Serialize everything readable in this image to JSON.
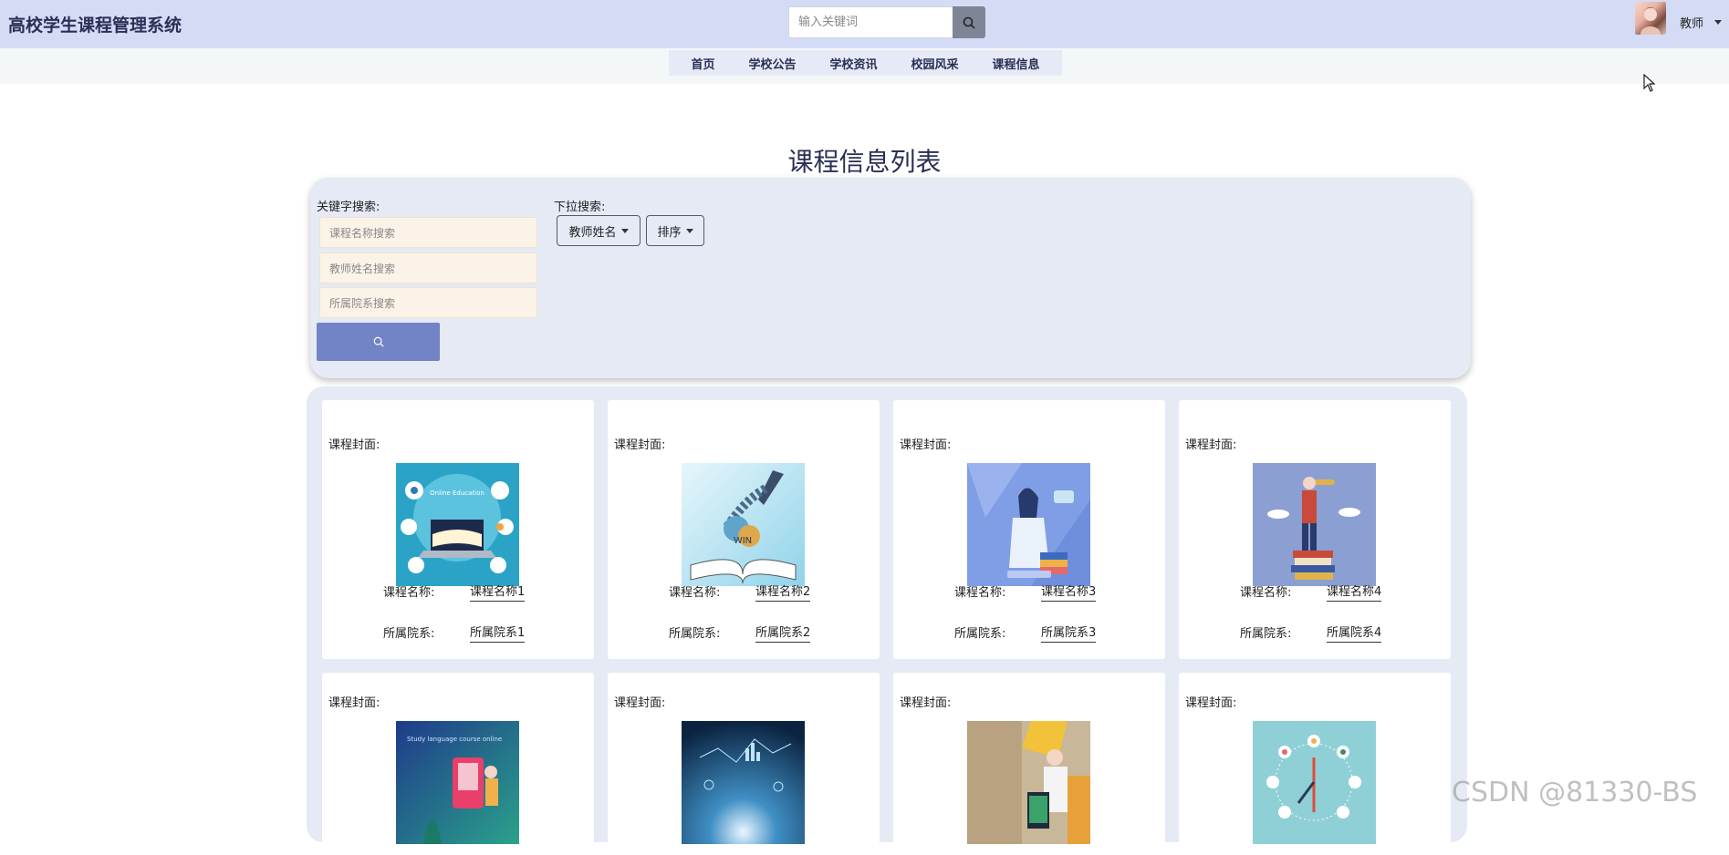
{
  "app": {
    "title": "高校学生课程管理系统"
  },
  "header": {
    "search_placeholder": "输入关键词",
    "user_role": "教师"
  },
  "nav": {
    "items": [
      "首页",
      "学校公告",
      "学校资讯",
      "校园风采",
      "课程信息"
    ]
  },
  "page": {
    "title": "课程信息列表"
  },
  "search_panel": {
    "keyword_label": "关键字搜索:",
    "keyword_placeholders": [
      "课程名称搜索",
      "教师姓名搜索",
      "所属院系搜索"
    ],
    "dropdown_label": "下拉搜索:",
    "dropdowns": [
      "教师姓名",
      "排序"
    ]
  },
  "cards": [
    {
      "cover_label": "课程封面:",
      "name_label": "课程名称:",
      "name": "课程名称1",
      "dept_label": "所属院系:",
      "dept": "所属院系1"
    },
    {
      "cover_label": "课程封面:",
      "name_label": "课程名称:",
      "name": "课程名称2",
      "dept_label": "所属院系:",
      "dept": "所属院系2"
    },
    {
      "cover_label": "课程封面:",
      "name_label": "课程名称:",
      "name": "课程名称3",
      "dept_label": "所属院系:",
      "dept": "所属院系3"
    },
    {
      "cover_label": "课程封面:",
      "name_label": "课程名称:",
      "name": "课程名称4",
      "dept_label": "所属院系:",
      "dept": "所属院系4"
    },
    {
      "cover_label": "课程封面:"
    },
    {
      "cover_label": "课程封面:"
    },
    {
      "cover_label": "课程封面:"
    },
    {
      "cover_label": "课程封面:"
    }
  ],
  "cover_images": [
    {
      "text": "Online Education"
    },
    {
      "text": "WIN"
    },
    {
      "text": ""
    },
    {
      "text": ""
    },
    {
      "text": "Study language course online"
    },
    {
      "text": ""
    },
    {
      "text": ""
    },
    {
      "text": ""
    }
  ],
  "watermark": "CSDN @81330-BS",
  "colors": {
    "header_bg": "#d4dcf5",
    "panel_bg": "#e5eaf5",
    "accent": "#7283c6",
    "input_bg": "#fcf3e8"
  }
}
